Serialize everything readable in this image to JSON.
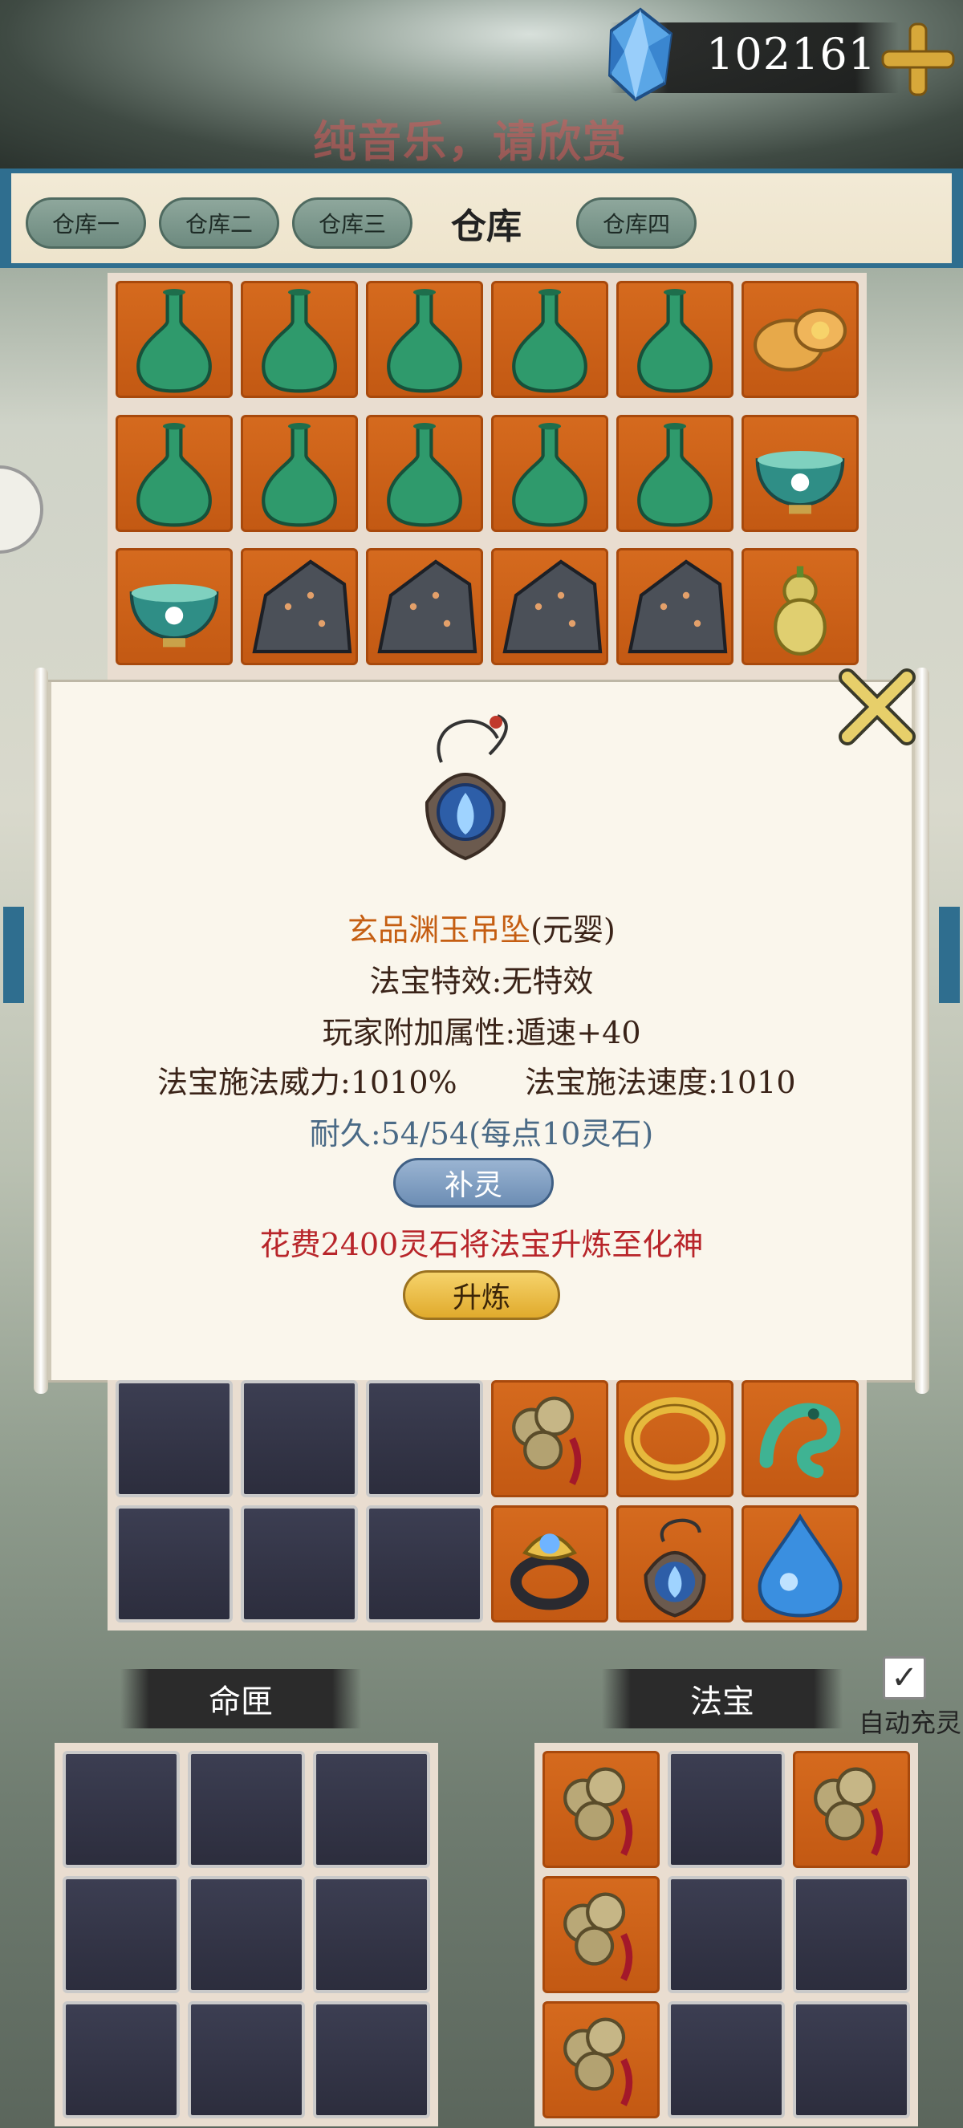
{
  "currency": {
    "value": "102161",
    "icon": "crystal-gem-icon"
  },
  "banner_text": "纯音乐，请欣赏",
  "tabs": {
    "tab1": "仓库一",
    "tab2": "仓库二",
    "tab3": "仓库三",
    "active": "仓库",
    "tab4": "仓库四"
  },
  "warehouse_top": [
    "vase-icon",
    "vase-icon",
    "vase-icon",
    "vase-icon",
    "vase-icon",
    "mooncake-icon",
    "vase-icon",
    "vase-icon",
    "vase-icon",
    "vase-icon",
    "vase-icon",
    "lotus-bowl-icon",
    "lotus-bowl-icon",
    "ore-rock-icon",
    "ore-rock-icon",
    "ore-rock-icon",
    "ore-rock-icon",
    "gourd-icon"
  ],
  "dialog": {
    "item_name": "玄品渊玉吊坠",
    "item_stage": "(元婴)",
    "special_effect": "法宝特效:无特效",
    "player_bonus": "玩家附加属性:遁速+40",
    "cast_power": "法宝施法威力:1010%",
    "cast_speed": "法宝施法速度:1010",
    "durability": "耐久:54/54(每点10灵石)",
    "refill_button": "补灵",
    "cost_text": "花费2400灵石将法宝升炼至化神",
    "refine_button": "升炼"
  },
  "warehouse_bottom": [
    "empty",
    "empty",
    "empty",
    "coin-string-icon",
    "gold-ring-icon",
    "jade-dragon-icon",
    "empty",
    "empty",
    "empty",
    "lotus-ring-icon",
    "pendant-icon",
    "water-drop-icon"
  ],
  "sections": {
    "fate_box": "命匣",
    "treasure": "法宝",
    "auto_refill": "自动充灵",
    "auto_refill_checked": "✓"
  },
  "fate_grid": [
    "empty",
    "empty",
    "empty",
    "empty",
    "empty",
    "empty",
    "empty",
    "empty",
    "empty"
  ],
  "treasure_grid": [
    "coin-string-icon",
    "empty",
    "coin-string-icon",
    "coin-string-icon",
    "empty",
    "empty",
    "coin-string-icon",
    "empty",
    "empty"
  ],
  "colors": {
    "slot_filled": "#d56a1e",
    "slot_empty": "#32344a",
    "accent_blue": "#2f6e8f"
  }
}
